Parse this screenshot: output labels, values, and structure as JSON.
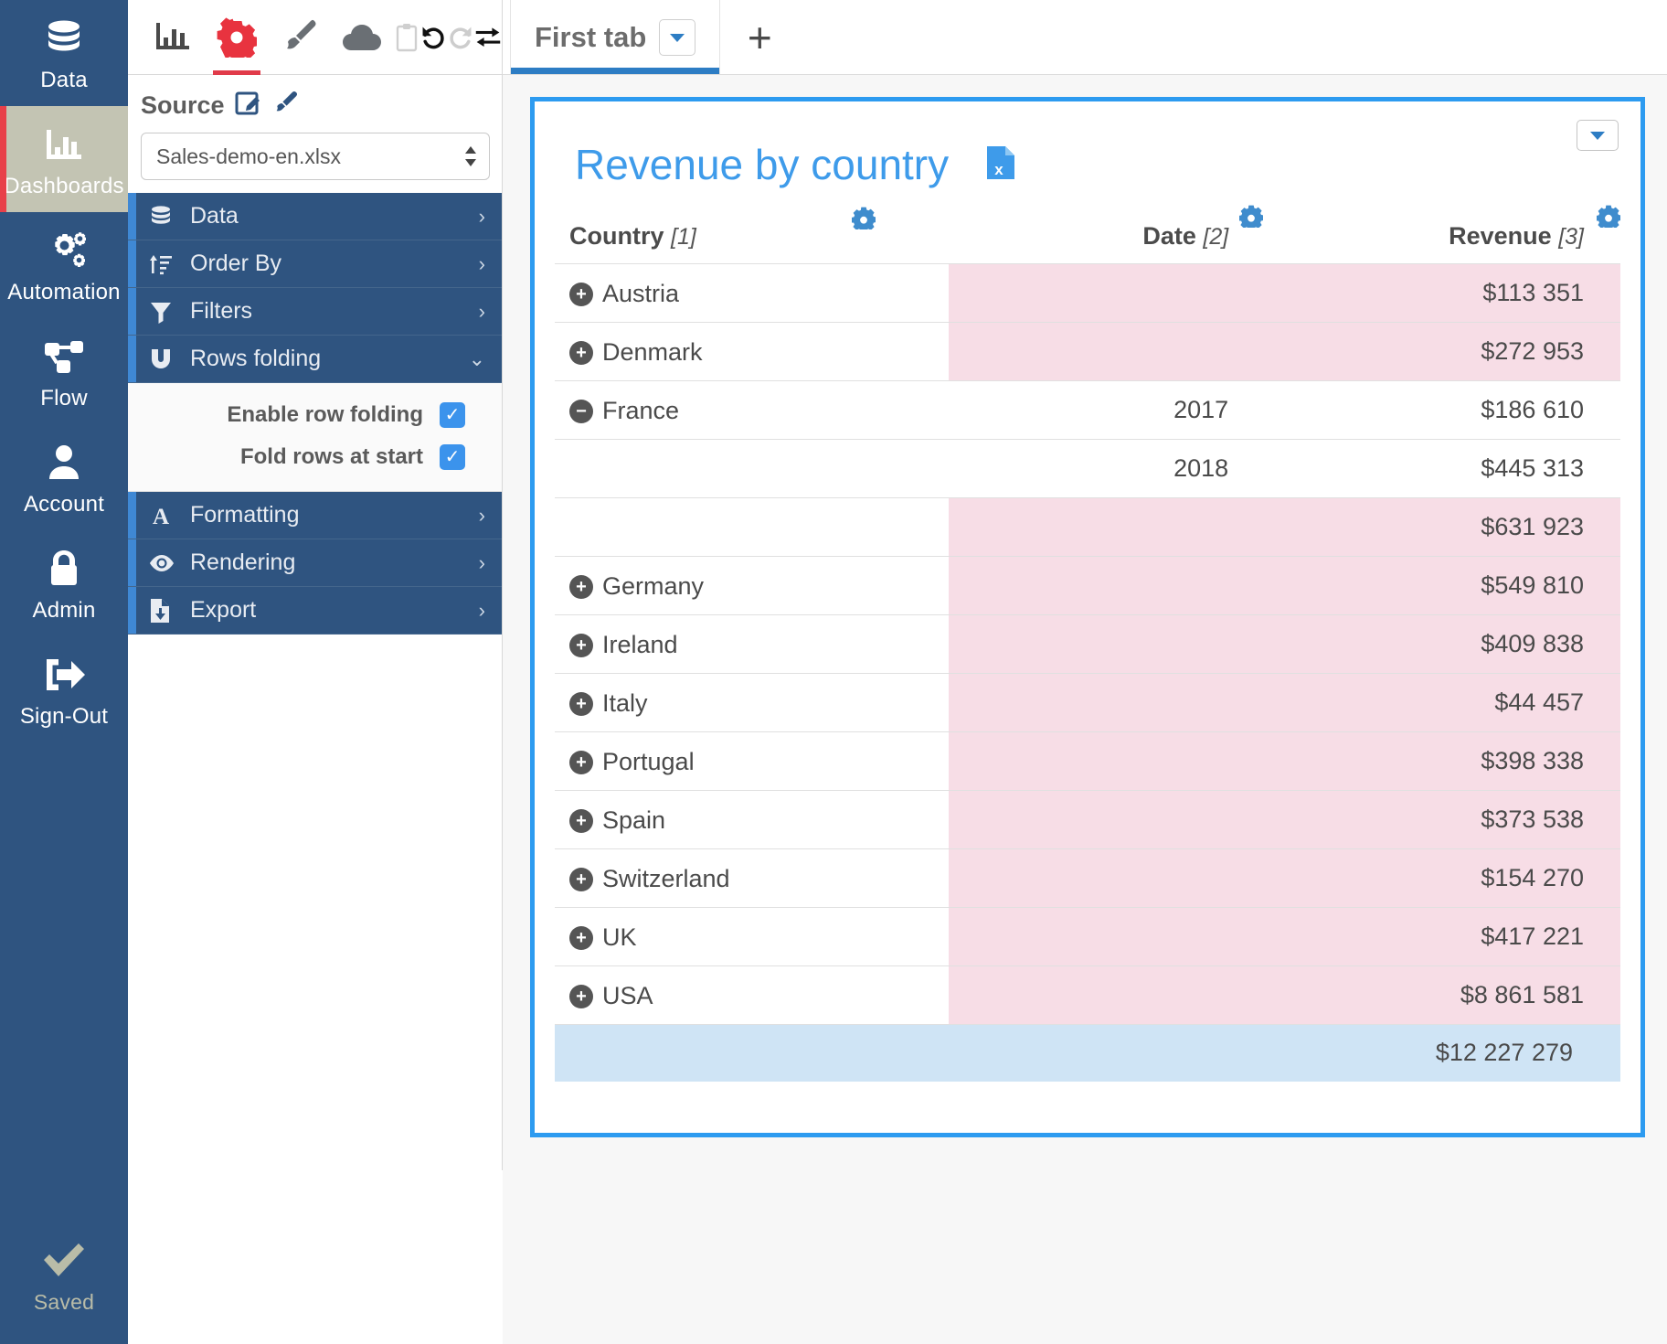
{
  "sidebar": {
    "items": [
      {
        "label": "Data",
        "icon": "database-icon",
        "active": false
      },
      {
        "label": "Dashboards",
        "icon": "bar-chart-icon",
        "active": true
      },
      {
        "label": "Automation",
        "icon": "gears-icon",
        "active": false
      },
      {
        "label": "Flow",
        "icon": "flow-nodes-icon",
        "active": false
      },
      {
        "label": "Account",
        "icon": "user-icon",
        "active": false
      },
      {
        "label": "Admin",
        "icon": "lock-icon",
        "active": false
      },
      {
        "label": "Sign-Out",
        "icon": "sign-out-icon",
        "active": false
      }
    ],
    "status": {
      "label": "Saved",
      "icon": "check-icon"
    },
    "colors": {
      "bg": "#2f5480",
      "active_bg": "#c3c4b3",
      "active_accent": "#e8404a",
      "saved_text": "#b9bca8"
    }
  },
  "toolbar": {
    "buttons": [
      {
        "name": "chart-icon",
        "title": "Chart",
        "active": false
      },
      {
        "name": "gear-icon",
        "title": "Settings",
        "active": true
      },
      {
        "name": "paintbrush-icon",
        "title": "Style",
        "active": false
      },
      {
        "name": "cloud-icon",
        "title": "Cloud",
        "active": false
      },
      {
        "name": "clipboard-icon",
        "title": "Clipboard",
        "active": false
      },
      {
        "name": "undo-icon",
        "title": "Undo",
        "active": false
      },
      {
        "name": "redo-icon",
        "title": "Redo",
        "active": false
      },
      {
        "name": "swap-icon",
        "title": "Swap",
        "active": false
      }
    ],
    "accent": "#e13b4a"
  },
  "source": {
    "title": "Source",
    "edit_icon": "edit-square-icon",
    "brush_icon": "paintbrush-icon",
    "selected_file": "Sales-demo-en.xlsx"
  },
  "menu": {
    "items": [
      {
        "label": "Data",
        "icon": "database-icon",
        "chevron": "›",
        "expanded": false
      },
      {
        "label": "Order By",
        "icon": "sort-icon",
        "chevron": "›",
        "expanded": false
      },
      {
        "label": "Filters",
        "icon": "funnel-icon",
        "chevron": "›",
        "expanded": false
      },
      {
        "label": "Rows folding",
        "icon": "magnet-icon",
        "chevron": "⌄",
        "expanded": true
      }
    ],
    "items_after": [
      {
        "label": "Formatting",
        "icon": "font-a-icon",
        "chevron": "›",
        "expanded": false
      },
      {
        "label": "Rendering",
        "icon": "eye-icon",
        "chevron": "›",
        "expanded": false
      },
      {
        "label": "Export",
        "icon": "file-download-icon",
        "chevron": "›",
        "expanded": false
      }
    ],
    "rows_folding_options": [
      {
        "label": "Enable row folding",
        "checked": true
      },
      {
        "label": "Fold rows at start",
        "checked": true
      }
    ],
    "accent_bar": "#3f88d4",
    "bg": "#2f5480"
  },
  "tabs": {
    "list": [
      {
        "label": "First tab",
        "active": true,
        "dropdown_icon": "chevron-down-icon"
      }
    ],
    "add_label": "+",
    "active_underline": "#2d7dc4"
  },
  "widget": {
    "title": "Revenue by country",
    "export_icon": "excel-file-icon",
    "menu_icon": "chevron-down-icon",
    "border_color": "#2d9bf0",
    "title_color": "#3e9bea"
  },
  "chart_data": {
    "type": "table",
    "title": "Revenue by country",
    "columns": [
      {
        "label": "Country",
        "index": "[1]",
        "gear": "gear-icon"
      },
      {
        "label": "Date",
        "index": "[2]",
        "gear": "gear-icon"
      },
      {
        "label": "Revenue",
        "index": "[3]",
        "gear": "gear-icon"
      }
    ],
    "rows": [
      {
        "country": "Austria",
        "state": "collapsed",
        "date": "",
        "revenue": "$113 351",
        "highlight": "pink"
      },
      {
        "country": "Denmark",
        "state": "collapsed",
        "date": "",
        "revenue": "$272 953",
        "highlight": "pink"
      },
      {
        "country": "France",
        "state": "expanded",
        "date": "2017",
        "revenue": "$186 610",
        "highlight": "none"
      },
      {
        "country": "",
        "state": "child",
        "date": "2018",
        "revenue": "$445 313",
        "highlight": "none"
      },
      {
        "country": "",
        "state": "subtotal",
        "date": "",
        "revenue": "$631 923",
        "highlight": "pink"
      },
      {
        "country": "Germany",
        "state": "collapsed",
        "date": "",
        "revenue": "$549 810",
        "highlight": "pink"
      },
      {
        "country": "Ireland",
        "state": "collapsed",
        "date": "",
        "revenue": "$409 838",
        "highlight": "pink"
      },
      {
        "country": "Italy",
        "state": "collapsed",
        "date": "",
        "revenue": "$44 457",
        "highlight": "pink"
      },
      {
        "country": "Portugal",
        "state": "collapsed",
        "date": "",
        "revenue": "$398 338",
        "highlight": "pink"
      },
      {
        "country": "Spain",
        "state": "collapsed",
        "date": "",
        "revenue": "$373 538",
        "highlight": "pink"
      },
      {
        "country": "Switzerland",
        "state": "collapsed",
        "date": "",
        "revenue": "$154 270",
        "highlight": "pink"
      },
      {
        "country": "UK",
        "state": "collapsed",
        "date": "",
        "revenue": "$417 221",
        "highlight": "pink"
      },
      {
        "country": "USA",
        "state": "collapsed",
        "date": "",
        "revenue": "$8 861 581",
        "highlight": "pink"
      }
    ],
    "total": {
      "country": "",
      "date": "",
      "revenue": "$12 227 279",
      "highlight": "blue"
    },
    "colors": {
      "pink": "#f7dde6",
      "total_blue": "#cfe4f5",
      "gear": "#3f8ccd"
    }
  }
}
